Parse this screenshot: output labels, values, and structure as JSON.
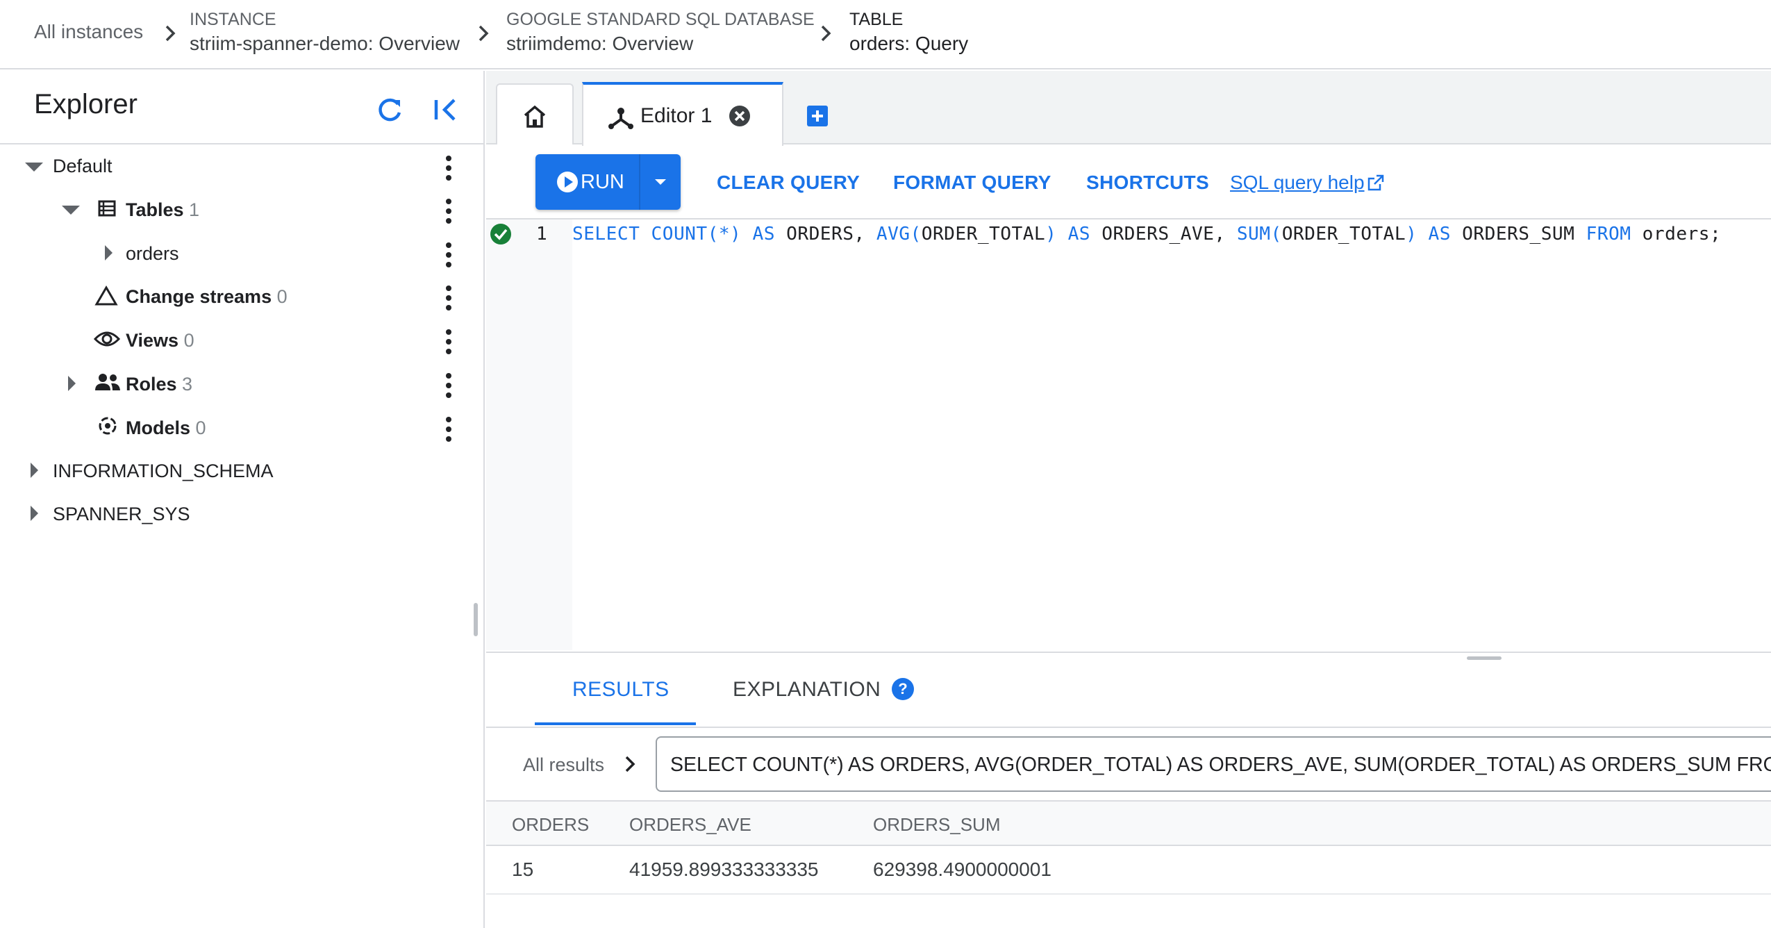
{
  "breadcrumb": {
    "all_instances": "All instances",
    "items": [
      {
        "type": "INSTANCE",
        "name": "striim-spanner-demo: Overview"
      },
      {
        "type": "GOOGLE STANDARD SQL DATABASE",
        "name": "striimdemo: Overview"
      },
      {
        "type": "TABLE",
        "name": "orders: Query"
      }
    ]
  },
  "explorer": {
    "title": "Explorer",
    "tree": {
      "default_label": "Default",
      "tables_label": "Tables",
      "tables_count": "1",
      "orders_label": "orders",
      "change_streams_label": "Change streams",
      "change_streams_count": "0",
      "views_label": "Views",
      "views_count": "0",
      "roles_label": "Roles",
      "roles_count": "3",
      "models_label": "Models",
      "models_count": "0",
      "information_schema_label": "INFORMATION_SCHEMA",
      "spanner_sys_label": "SPANNER_SYS"
    }
  },
  "tabs": {
    "editor_label": "Editor 1"
  },
  "toolbar": {
    "run_label": "RUN",
    "clear_query": "CLEAR QUERY",
    "format_query": "FORMAT QUERY",
    "shortcuts": "SHORTCUTS",
    "help_link": "SQL query help"
  },
  "editor": {
    "line_number": "1",
    "status": "valid",
    "code_tokens": [
      {
        "text": "SELECT",
        "kw": true
      },
      {
        "text": " ",
        "kw": false
      },
      {
        "text": "COUNT(*)",
        "kw": true
      },
      {
        "text": " ",
        "kw": false
      },
      {
        "text": "AS",
        "kw": true
      },
      {
        "text": " ORDERS, ",
        "kw": false
      },
      {
        "text": "AVG(",
        "kw": true
      },
      {
        "text": "ORDER_TOTAL",
        "kw": false
      },
      {
        "text": ")",
        "kw": true
      },
      {
        "text": " ",
        "kw": false
      },
      {
        "text": "AS",
        "kw": true
      },
      {
        "text": " ORDERS_AVE, ",
        "kw": false
      },
      {
        "text": "SUM(",
        "kw": true
      },
      {
        "text": "ORDER_TOTAL",
        "kw": false
      },
      {
        "text": ")",
        "kw": true
      },
      {
        "text": " ",
        "kw": false
      },
      {
        "text": "AS",
        "kw": true
      },
      {
        "text": " ORDERS_SUM ",
        "kw": false
      },
      {
        "text": "FROM",
        "kw": true
      },
      {
        "text": " orders;",
        "kw": false
      }
    ]
  },
  "results": {
    "tab_results": "RESULTS",
    "tab_explanation": "EXPLANATION",
    "help_glyph": "?",
    "all_results": "All results",
    "query_text": "SELECT COUNT(*) AS ORDERS, AVG(ORDER_TOTAL) AS ORDERS_AVE, SUM(ORDER_TOTAL) AS ORDERS_SUM FROM orders",
    "columns": [
      "ORDERS",
      "ORDERS_AVE",
      "ORDERS_SUM"
    ],
    "rows": [
      [
        "15",
        "41959.899333333335",
        "629398.4900000001"
      ]
    ]
  },
  "colors": {
    "accent": "#1a73e8",
    "success": "#188038",
    "text": "#202124",
    "muted": "#5f6368"
  }
}
